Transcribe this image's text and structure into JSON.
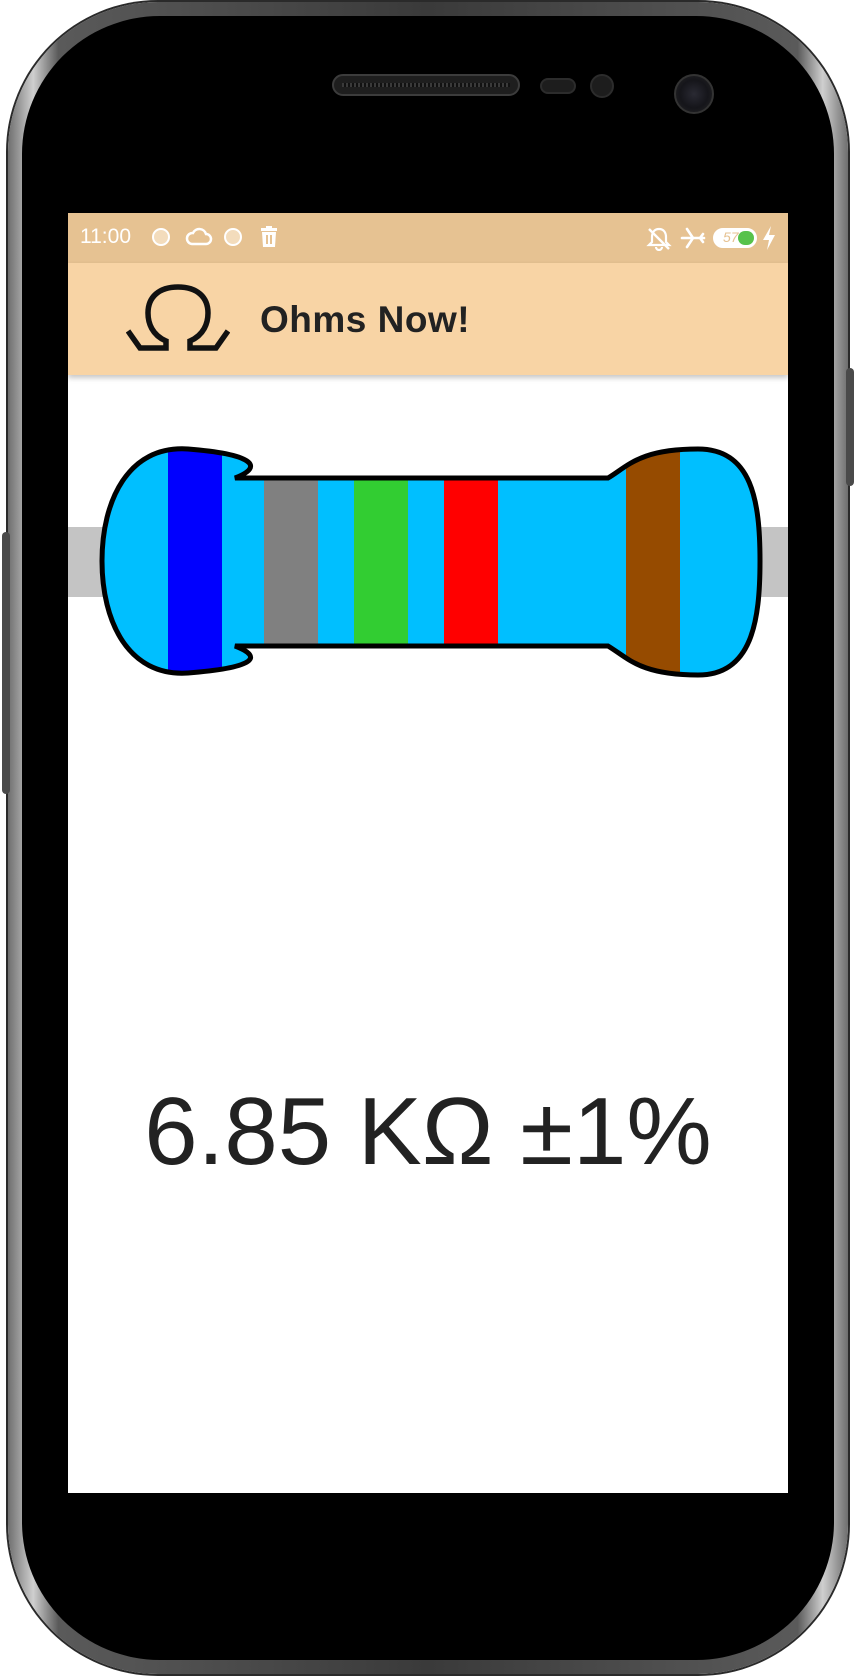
{
  "status_bar": {
    "time": "11:00",
    "battery_level": "57",
    "icons": [
      "notification-dot-icon",
      "cloud-icon",
      "notification-dot-icon",
      "trash-icon",
      "mute-notifications-icon",
      "airplane-mode-icon",
      "battery-icon",
      "charging-bolt-icon"
    ]
  },
  "app_bar": {
    "title": "Ohms Now!",
    "logo": "omega-icon",
    "background": "#f8d4a5"
  },
  "resistor": {
    "body_color": "#00bfff",
    "lead_color": "#c4c4c4",
    "bands": [
      {
        "name": "band-1",
        "color": "#0000ff",
        "meaning": "blue"
      },
      {
        "name": "band-2",
        "color": "#808080",
        "meaning": "gray"
      },
      {
        "name": "band-3",
        "color": "#32cd32",
        "meaning": "green"
      },
      {
        "name": "band-4",
        "color": "#ff0000",
        "meaning": "red"
      },
      {
        "name": "tolerance-band",
        "color": "#964b00",
        "meaning": "brown"
      }
    ]
  },
  "result": {
    "value_text": "6.85 KΩ ±1%"
  }
}
